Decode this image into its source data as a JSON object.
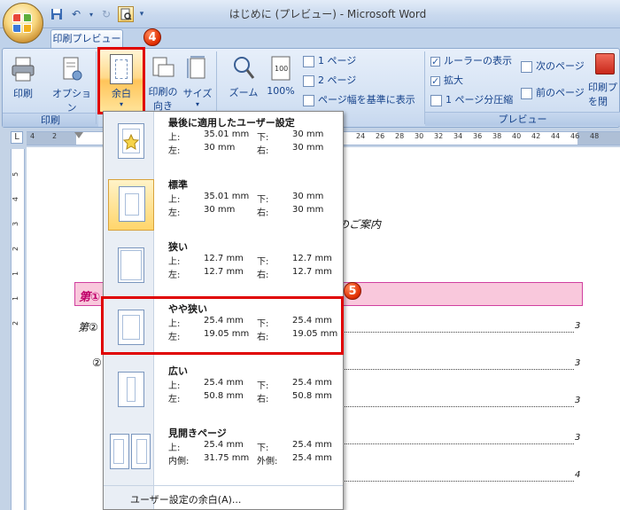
{
  "window": {
    "title": "はじめに (プレビュー) - Microsoft Word"
  },
  "quick_access": {
    "save_icon": "save-icon",
    "undo_icon": "undo-icon",
    "redo_icon": "redo-icon",
    "preview_icon": "print-preview-icon",
    "customize_icon": "dropdown-arrow-icon"
  },
  "tabs": {
    "active": "印刷プレビュー"
  },
  "ribbon": {
    "print_group": {
      "label": "印刷",
      "print": "印刷",
      "options": "オプション"
    },
    "page_setup": {
      "margins": "余白",
      "orientation_line1": "印刷の",
      "orientation_line2": "向き",
      "size": "サイズ"
    },
    "zoom_group": {
      "zoom": "ズーム",
      "zoom_100": "100%",
      "one_page": "1 ページ",
      "two_pages": "2 ページ",
      "page_width": "ページ幅を基準に表示"
    },
    "preview_group": {
      "label": "プレビュー",
      "show_ruler": "ルーラーの表示",
      "magnifier": "拡大",
      "shrink_one_page": "1 ページ分圧縮",
      "next_page": "次のページ",
      "prev_page": "前のページ",
      "close_line1": "印刷プ",
      "close_line2": "を閉"
    }
  },
  "callouts": {
    "step4": "4",
    "step5": "5"
  },
  "ruler": {
    "corner": "L",
    "left_numbers": [
      "4",
      "2"
    ],
    "right_numbers": [
      "24",
      "26",
      "28",
      "30",
      "32",
      "34",
      "36",
      "38",
      "40",
      "42",
      "44",
      "46",
      "48"
    ],
    "vertical_numbers": [
      "2",
      "1",
      "1",
      "2",
      "3",
      "4",
      "5"
    ]
  },
  "document": {
    "visible_fragment": "のご案内",
    "heading_fragment": "第①",
    "line2_fragment": "第②",
    "line3_fragment": "②",
    "page_numbers": [
      "3",
      "3",
      "3",
      "3",
      "4"
    ]
  },
  "margins_menu": {
    "labels": {
      "top": "上:",
      "bottom": "下:",
      "left": "左:",
      "right": "右:",
      "inside": "内側:",
      "outside": "外側:"
    },
    "options": [
      {
        "name": "最後に適用したユーザー設定",
        "top": "35.01 mm",
        "bottom": "30 mm",
        "left": "30 mm",
        "right": "30 mm",
        "icon": "star-icon"
      },
      {
        "name": "標準",
        "top": "35.01 mm",
        "bottom": "30 mm",
        "left": "30 mm",
        "right": "30 mm",
        "selected": true
      },
      {
        "name": "狭い",
        "top": "12.7 mm",
        "bottom": "12.7 mm",
        "left": "12.7 mm",
        "right": "12.7 mm"
      },
      {
        "name": "やや狭い",
        "top": "25.4 mm",
        "bottom": "25.4 mm",
        "left": "19.05 mm",
        "right": "19.05 mm"
      },
      {
        "name": "広い",
        "top": "25.4 mm",
        "bottom": "25.4 mm",
        "left": "50.8 mm",
        "right": "50.8 mm"
      },
      {
        "name": "見開きページ",
        "top": "25.4 mm",
        "bottom": "25.4 mm",
        "inside": "31.75 mm",
        "outside": "25.4 mm"
      }
    ],
    "custom": "ユーザー設定の余白(A)..."
  },
  "colors": {
    "accent_red": "#e00000",
    "selected_orange": "#ffd56b",
    "heading_pink": "#f9c8dc"
  }
}
